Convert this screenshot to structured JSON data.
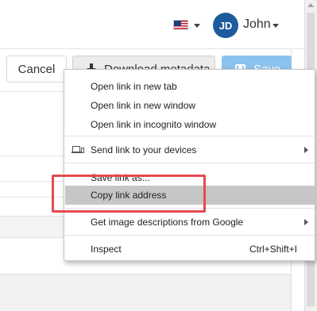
{
  "header": {
    "language_icon": "us-flag-icon",
    "user": {
      "initials": "JD",
      "name": "John",
      "avatar_color": "#1d5b9d"
    }
  },
  "toolbar": {
    "cancel_label": "Cancel",
    "download_label": "Download metadata",
    "save_label": "Save",
    "save_color": "#8cc2ee"
  },
  "context_menu": {
    "items": [
      {
        "label": "Open link in new tab"
      },
      {
        "label": "Open link in new window"
      },
      {
        "label": "Open link in incognito window"
      },
      {
        "label": "Send link to your devices",
        "icon": "devices-icon",
        "submenu": true
      },
      {
        "label": "Save link as..."
      },
      {
        "label": "Copy link address",
        "highlighted": true
      },
      {
        "label": "Get image descriptions from Google",
        "submenu": true
      },
      {
        "label": "Inspect",
        "shortcut": "Ctrl+Shift+I"
      }
    ],
    "highlight_color": "#e54a50"
  }
}
